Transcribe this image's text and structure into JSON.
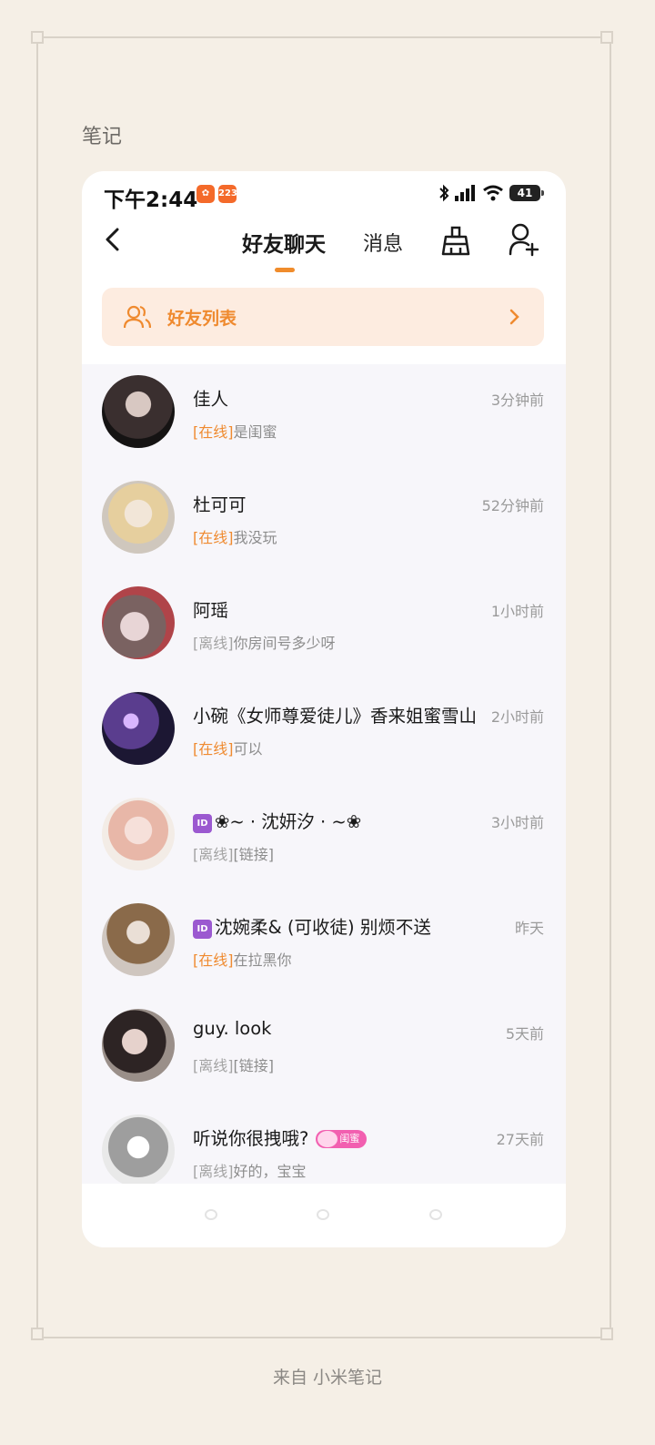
{
  "note": {
    "title": "笔记",
    "footer": "来自 小米笔记"
  },
  "status_bar": {
    "time": "下午2:44",
    "badge_1": "",
    "badge_2": "223",
    "battery": "41"
  },
  "header": {
    "tab_active": "好友聊天",
    "tab_messages": "消息",
    "icons": [
      "back-icon",
      "broom-icon",
      "add-user-icon"
    ]
  },
  "friend_bar": {
    "label": "好友列表"
  },
  "colors": {
    "accent": "#ef8a2f",
    "accent_bg": "#fdece0",
    "page_bg": "#f5efe6",
    "list_bg": "#f7f6fa"
  },
  "chats": [
    {
      "name": "佳人",
      "time": "3分钟前",
      "status": "[在线]",
      "online": true,
      "msg": "是闺蜜"
    },
    {
      "name": "杜可可",
      "time": "52分钟前",
      "status": "[在线]",
      "online": true,
      "msg": "我没玩"
    },
    {
      "name": "阿瑶",
      "time": "1小时前",
      "status": "[离线]",
      "online": false,
      "msg": "你房间号多少呀"
    },
    {
      "name": "小碗《女师尊爱徒儿》香来姐蜜雪山",
      "time": "2小时前",
      "status": "[在线]",
      "online": true,
      "msg": "可以"
    },
    {
      "name": "❀~ · 沈妍汐 · ~❀",
      "id_badge": "ID",
      "time": "3小时前",
      "status": "[离线]",
      "online": false,
      "msg": "[链接]"
    },
    {
      "name": "沈婉柔& (可收徒) 别烦不送",
      "id_badge": "ID",
      "time": "昨天",
      "status": "[在线]",
      "online": true,
      "msg": "在拉黑你"
    },
    {
      "name": "guy. look",
      "time": "5天前",
      "status": "[离线]",
      "online": false,
      "msg": "[链接]"
    },
    {
      "name": "听说你很拽哦?",
      "tag": "闺蜜",
      "time": "27天前",
      "status": "[离线]",
      "online": false,
      "msg": "好的，宝宝"
    }
  ]
}
